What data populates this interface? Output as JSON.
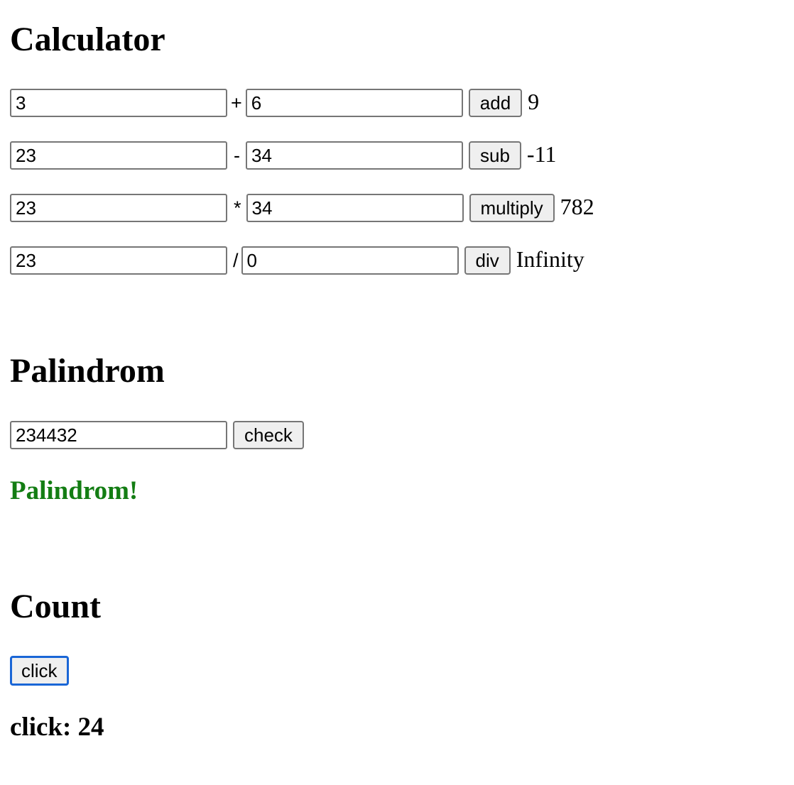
{
  "calculator": {
    "title": "Calculator",
    "rows": [
      {
        "a": "3",
        "op": "+",
        "b": "6",
        "button": "add",
        "result": "9"
      },
      {
        "a": "23",
        "op": "-",
        "b": "34",
        "button": "sub",
        "result": "-11"
      },
      {
        "a": "23",
        "op": "*",
        "b": "34",
        "button": "multiply",
        "result": "782"
      },
      {
        "a": "23",
        "op": "/",
        "b": "0",
        "button": "div",
        "result": "Infinity"
      }
    ]
  },
  "palindrome": {
    "title": "Palindrom",
    "input_value": "234432",
    "button": "check",
    "result": "Palindrom!",
    "result_color": "#137d13"
  },
  "count": {
    "title": "Count",
    "button": "click",
    "label": "click",
    "value": 24,
    "result_text": "click: 24",
    "focus_color": "#1a66d6"
  }
}
